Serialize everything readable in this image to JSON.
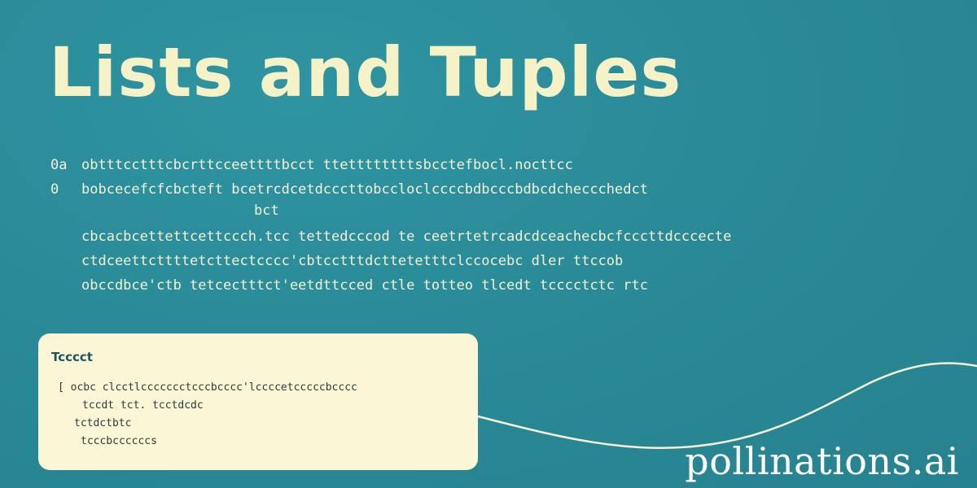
{
  "slide": {
    "title": "Lists and Tuples",
    "body_lines": [
      {
        "marker": "0a",
        "text": "obtttcctttcbcrttcceettttbcct ttettttttttsbcctefbocl.nocttcc"
      },
      {
        "marker": "0",
        "text": "bobcecefcfcbcteft bcetrcdcetdcccttobccloclccccbdbcccbdbcdcheccchedct"
      },
      {
        "marker": "",
        "text": "bct"
      },
      {
        "marker": "",
        "text": "cbcacbcettettcettccch.tcc tettedcccod te ceetrtetrcadcdceachecbcfcccttdcccecte"
      },
      {
        "marker": "",
        "text": "ctdceettcttttetcttectcccc'cbtcctttdcttetetttclccocebc dler ttccob"
      },
      {
        "marker": "",
        "text": "obccdbce'ctb tetcectttct'eetdttcced ctle totteo tlcedt tcccctctc rtc"
      }
    ],
    "card": {
      "title": "Tcccct",
      "lines": [
        "[ ocbc clcctlccccccctcccbcccc'lccccetcccccbcccc",
        "tccdt tct. tcctdcdc",
        "tctdctbtc",
        "tcccbccccccs"
      ]
    }
  },
  "watermark": "pollinations.ai",
  "colors": {
    "background": "#2a8a98",
    "title": "#f6f2c8",
    "card": "#fbf7d6",
    "card_title": "#1f5561"
  }
}
